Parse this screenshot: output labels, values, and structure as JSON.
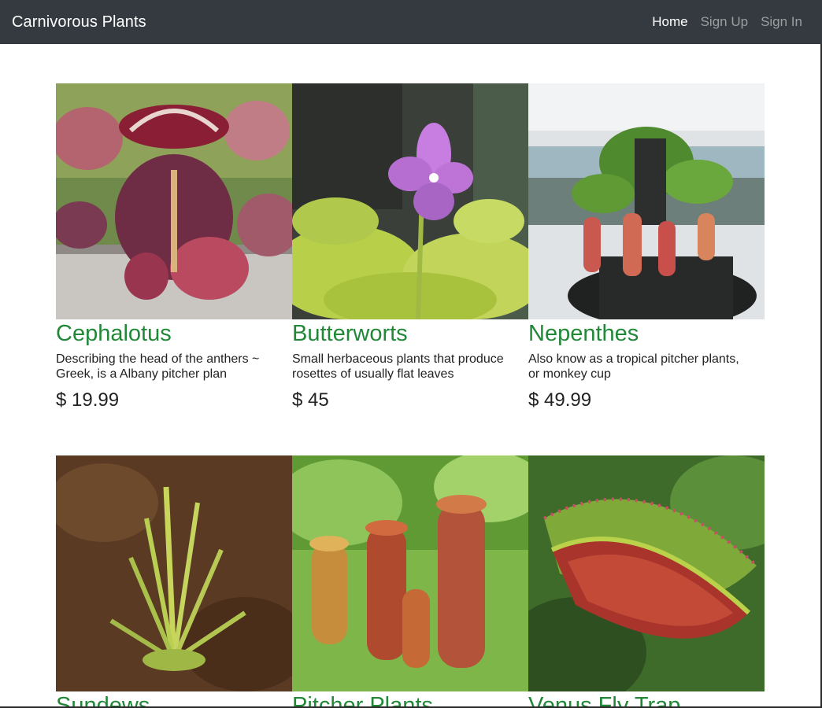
{
  "navbar": {
    "brand": "Carnivorous Plants",
    "links": [
      {
        "label": "Home",
        "active": true
      },
      {
        "label": "Sign Up",
        "active": false
      },
      {
        "label": "Sign In",
        "active": false
      }
    ]
  },
  "products": [
    {
      "name": "Cephalotus",
      "description": "Describing the head of the anthers ~ Greek, is a Albany pitcher plan",
      "price": "$ 19.99",
      "image": "cephalotus-photo"
    },
    {
      "name": "Butterworts",
      "description": "Small herbaceous plants that produce rosettes of usually flat leaves",
      "price": "$ 45",
      "image": "butterworts-photo"
    },
    {
      "name": "Nepenthes",
      "description": "Also know as a tropical pitcher plants, or monkey cup",
      "price": "$ 49.99",
      "image": "nepenthes-photo"
    },
    {
      "name": "Sundews",
      "image": "sundews-photo"
    },
    {
      "name": "Pitcher Plants",
      "image": "pitcher-plants-photo"
    },
    {
      "name": "Venus Fly Trap",
      "image": "venus-fly-trap-photo"
    }
  ],
  "colors": {
    "navbar_bg": "#343a40",
    "product_name": "#218838"
  }
}
